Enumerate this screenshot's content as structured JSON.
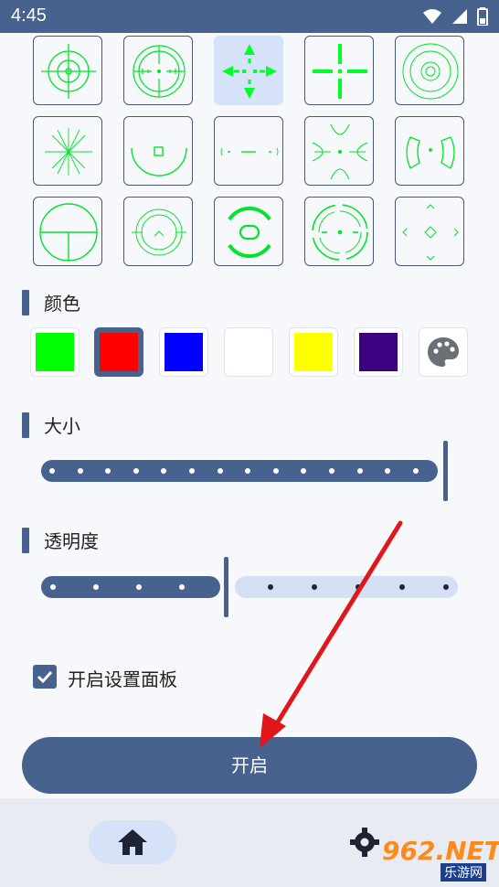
{
  "status_bar": {
    "time": "4:45",
    "icons": [
      "wifi-icon",
      "signal-icon",
      "battery-icon"
    ]
  },
  "crosshair_grid": {
    "selected_index": 2,
    "accent_color": "#00ff2a",
    "items": [
      "crosshair-circle-cross",
      "crosshair-scope-ticks",
      "crosshair-arrows",
      "crosshair-plus-gap",
      "crosshair-concentric",
      "crosshair-starburst",
      "crosshair-arc-square",
      "crosshair-dash-line",
      "crosshair-curved-x",
      "crosshair-bracket-arcs",
      "crosshair-circle-hline",
      "crosshair-circle-chevron",
      "crosshair-ring-oval",
      "crosshair-dashed-ring",
      "crosshair-diamond-chevrons"
    ]
  },
  "color_section": {
    "title": "颜色",
    "selected_index": 1,
    "swatches": [
      "#00ff00",
      "#ff0000",
      "#0000ff",
      "#ffffff",
      "#ffff00",
      "#3d0080"
    ],
    "palette_icon": "palette-icon"
  },
  "size_section": {
    "title": "大小",
    "value_fraction": 1.0
  },
  "opacity_section": {
    "title": "透明度",
    "value_fraction": 0.44
  },
  "settings_panel_checkbox": {
    "label": "开启设置面板",
    "checked": true
  },
  "start_button": {
    "label": "开启"
  },
  "bottom_nav": {
    "items": [
      "home-icon",
      "gear-icon"
    ],
    "selected": "home-icon"
  },
  "watermark": {
    "main": "962.NET",
    "sub": "乐游网"
  },
  "annotation": {
    "arrow_color": "#e0161b"
  }
}
